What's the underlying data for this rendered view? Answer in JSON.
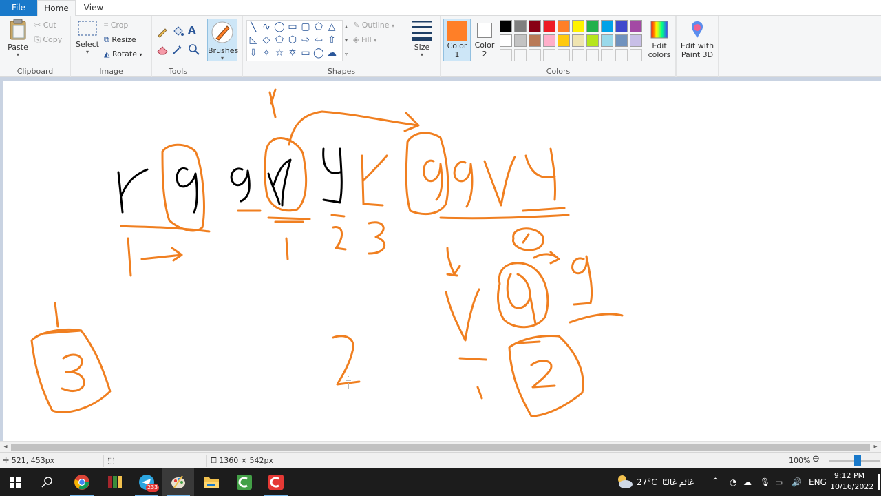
{
  "tabs": {
    "file": "File",
    "home": "Home",
    "view": "View"
  },
  "clipboard": {
    "paste": "Paste",
    "cut": "Cut",
    "copy": "Copy",
    "label": "Clipboard"
  },
  "image": {
    "select": "Select",
    "crop": "Crop",
    "resize": "Resize",
    "rotate": "Rotate",
    "label": "Image"
  },
  "tools": {
    "label": "Tools",
    "text_tool": "A"
  },
  "brushes": {
    "label": "Brushes"
  },
  "shapes": {
    "outline": "Outline",
    "fill": "Fill",
    "label": "Shapes"
  },
  "size": {
    "label": "Size"
  },
  "colors": {
    "color1_label": "Color",
    "color1_num": "1",
    "color2_label": "Color",
    "color2_num": "2",
    "color1_value": "#ff7f27",
    "color2_value": "#ffffff",
    "edit_colors_1": "Edit",
    "edit_colors_2": "colors",
    "label": "Colors",
    "palette_row1": [
      "#000000",
      "#7f7f7f",
      "#880015",
      "#ed1c24",
      "#ff7f27",
      "#fff200",
      "#22b14c",
      "#00a2e8",
      "#3f48cc",
      "#a349a4"
    ],
    "palette_row2": [
      "#ffffff",
      "#c3c3c3",
      "#b97a57",
      "#ffaec9",
      "#ffc90e",
      "#efe4b0",
      "#b5e61d",
      "#99d9ea",
      "#7092be",
      "#c8bfe7"
    ]
  },
  "paint3d": {
    "line1": "Edit with",
    "line2": "Paint 3D"
  },
  "status": {
    "cursor": "521, 453px",
    "canvas_size": "1360 × 542px",
    "zoom": "100%"
  },
  "taskbar": {
    "weather_temp": "27°C",
    "weather_text": "غائم غالبًا",
    "lang": "ENG",
    "time": "9:12 PM",
    "date": "10/16/2022",
    "telegram_badge": "233"
  }
}
